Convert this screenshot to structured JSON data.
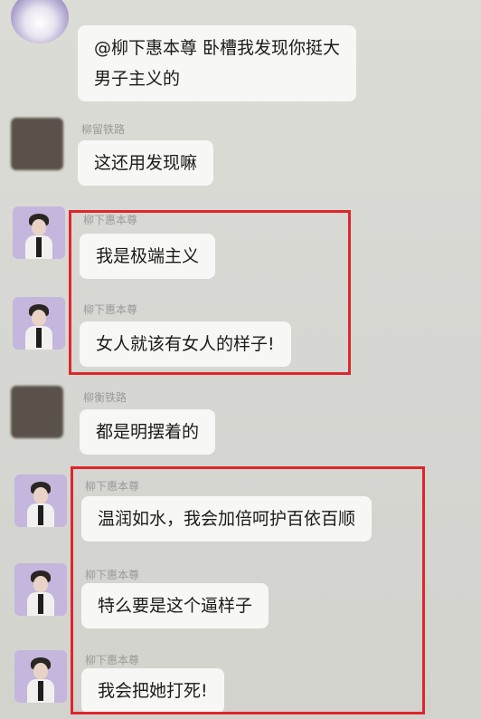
{
  "messages": [
    {
      "sender": "",
      "text_lines": [
        "@柳下惠本尊  卧槽我发现你挺大",
        "男子主义的"
      ],
      "avatar": "blob-avatar"
    },
    {
      "sender": "柳留铁路",
      "text_lines": [
        "这还用发现嘛"
      ],
      "avatar": "dark-avatar"
    },
    {
      "sender": "柳下惠本尊",
      "text_lines": [
        "我是极端主义"
      ],
      "avatar": "figure-avatar"
    },
    {
      "sender": "柳下惠本尊",
      "text_lines": [
        "女人就该有女人的样子!"
      ],
      "avatar": "figure-avatar"
    },
    {
      "sender": "柳衡铁路",
      "text_lines": [
        "都是明摆着的"
      ],
      "avatar": "dark-avatar"
    },
    {
      "sender": "柳下惠本尊",
      "text_lines": [
        "温润如水，我会加倍呵护百依百顺"
      ],
      "avatar": "figure-avatar"
    },
    {
      "sender": "柳下惠本尊",
      "text_lines": [
        "特么要是这个逼样子"
      ],
      "avatar": "figure-avatar"
    },
    {
      "sender": "柳下惠本尊",
      "text_lines": [
        "我会把她打死!"
      ],
      "avatar": "figure-avatar"
    }
  ],
  "colors": {
    "highlight_box": "#e0262b",
    "bubble": "#f7f7f5",
    "background": "#d9d9d4"
  }
}
